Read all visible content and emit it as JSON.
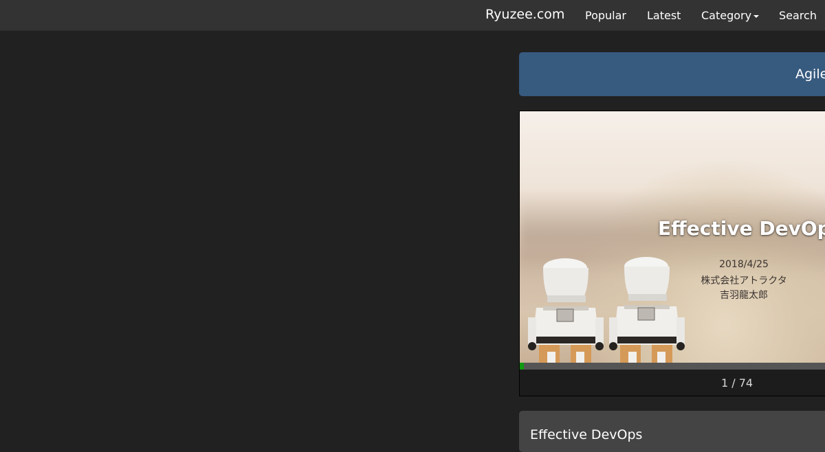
{
  "nav": {
    "brand": "Ryuzee.com",
    "items": [
      {
        "label": "Popular"
      },
      {
        "label": "Latest"
      },
      {
        "label": "Category"
      },
      {
        "label": "Search"
      }
    ]
  },
  "title_panel": {
    "text": "Agile"
  },
  "slide": {
    "heading": "Effective DevOps",
    "date": "2018/4/25",
    "company": "株式会社アトラクタ",
    "author": "吉羽龍太郎"
  },
  "pager": {
    "current": 1,
    "total": 74,
    "text": "1 / 74",
    "progress_fraction": 0.0135
  },
  "info_panel": {
    "title": "Effective DevOps"
  },
  "colors": {
    "navbar": "#333333",
    "background": "#212121",
    "title_panel": "#375a7f",
    "progress": "#109a10"
  }
}
